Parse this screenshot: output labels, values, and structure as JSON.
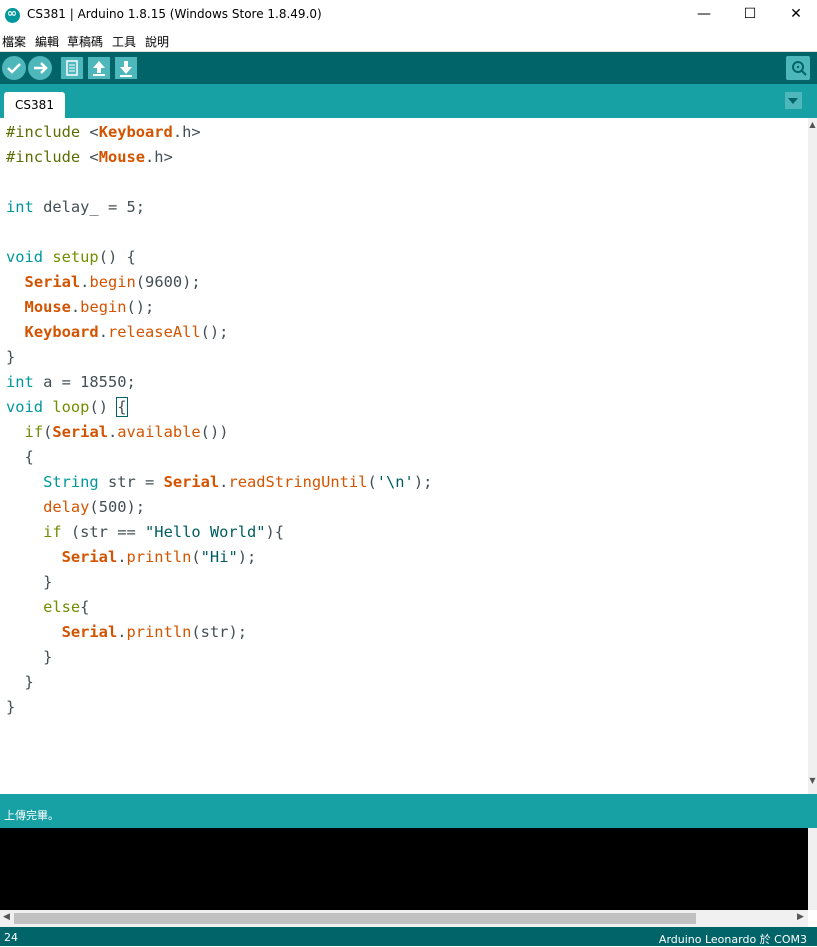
{
  "window": {
    "title": "CS381 | Arduino 1.8.15 (Windows Store 1.8.49.0)",
    "minimize": "—",
    "maximize": "☐",
    "close": "✕"
  },
  "menu": [
    "檔案",
    "編輯",
    "草稿碼",
    "工具",
    "說明"
  ],
  "toolbar": {
    "buttons": [
      "verify-icon",
      "upload-icon",
      "new-icon",
      "open-icon",
      "save-icon",
      "serial-monitor-icon"
    ]
  },
  "tab": {
    "label": "CS381"
  },
  "code": [
    "#include <Keyboard.h>",
    "#include <Mouse.h>",
    "",
    "int delay_ = 5;",
    "",
    "void setup() {",
    "  Serial.begin(9600);",
    "  Mouse.begin();",
    "  Keyboard.releaseAll();",
    "}",
    "int a = 18550;",
    "void loop() {",
    "  if(Serial.available())",
    "  {",
    "    String str = Serial.readStringUntil('\\n');",
    "    delay(500);",
    "    if (str == \"Hello World\"){",
    "      Serial.println(\"Hi\");",
    "    }",
    "    else{",
    "      Serial.println(str);",
    "    }",
    "  }",
    "}"
  ],
  "status": {
    "message": "上傳完畢。"
  },
  "footer": {
    "line": "24",
    "board": "Arduino Leonardo 於 COM3"
  },
  "colors": {
    "toolbar": "#006468",
    "tabbar": "#17a1a5",
    "keyword": "#00979c",
    "object": "#d35400"
  }
}
